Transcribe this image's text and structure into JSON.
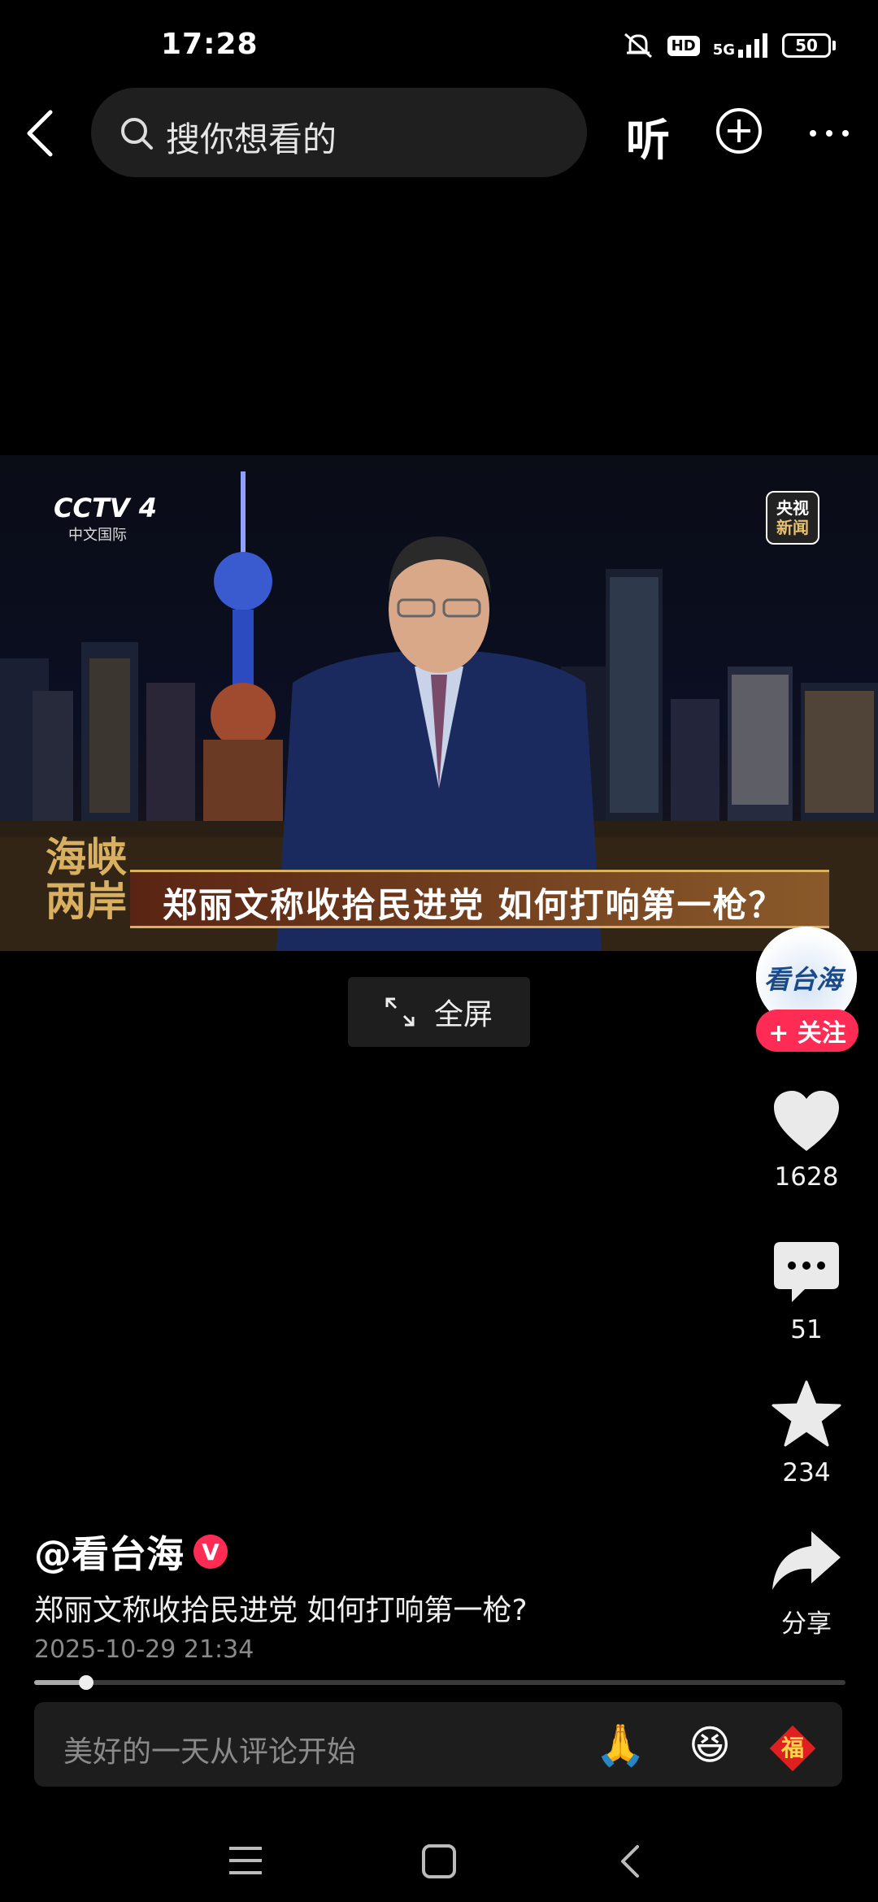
{
  "status_bar": {
    "time": "17:28",
    "network": "5G",
    "hd": "HD",
    "battery": "50"
  },
  "top_bar": {
    "search_placeholder": "搜你想看的",
    "listen_label": "听"
  },
  "video": {
    "channel_logo": "CCTV 4",
    "channel_sub": "中文国际",
    "corner_badge_line1": "央视",
    "corner_badge_line2": "新闻",
    "program_logo_line1": "海峡",
    "program_logo_line2": "两岸",
    "lower_third": "郑丽文称收拾民进党  如何打响第一枪？",
    "fullscreen_label": "全屏"
  },
  "sidebar": {
    "avatar_text": "看台海",
    "follow_label": "+ 关注",
    "like_count": "1628",
    "comment_count": "51",
    "favorite_count": "234",
    "share_label": "分享"
  },
  "caption": {
    "author": "@看台海",
    "verified": "V",
    "title": "郑丽文称收拾民进党 如何打响第一枪?",
    "timestamp": "2025-10-29 21:34"
  },
  "progress": {
    "fraction": 0.064
  },
  "comment_bar": {
    "placeholder": "美好的一天从评论开始",
    "emoji_1": "🙏",
    "emoji_2": "😆",
    "emoji_3": "福"
  },
  "colors": {
    "accent": "#fe2c55",
    "background": "#000000"
  }
}
